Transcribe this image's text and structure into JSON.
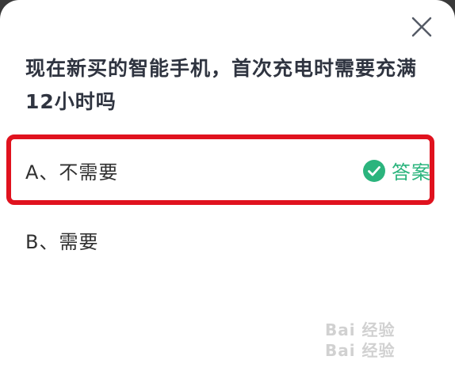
{
  "dialog": {
    "question": "现在新买的智能手机，首次充电时需要充满12小时吗",
    "close_icon": "close-icon"
  },
  "options": [
    {
      "label": "A、不需要",
      "is_answer": true,
      "answer_tag": "答案",
      "icon": "check-circle-icon",
      "answer_color": "#2bb47d"
    },
    {
      "label": "B、需要",
      "is_answer": false
    }
  ],
  "highlight": {
    "color": "#e0121e"
  },
  "watermark": {
    "line1": "Bai 经验",
    "line2": "Bai 经验"
  }
}
